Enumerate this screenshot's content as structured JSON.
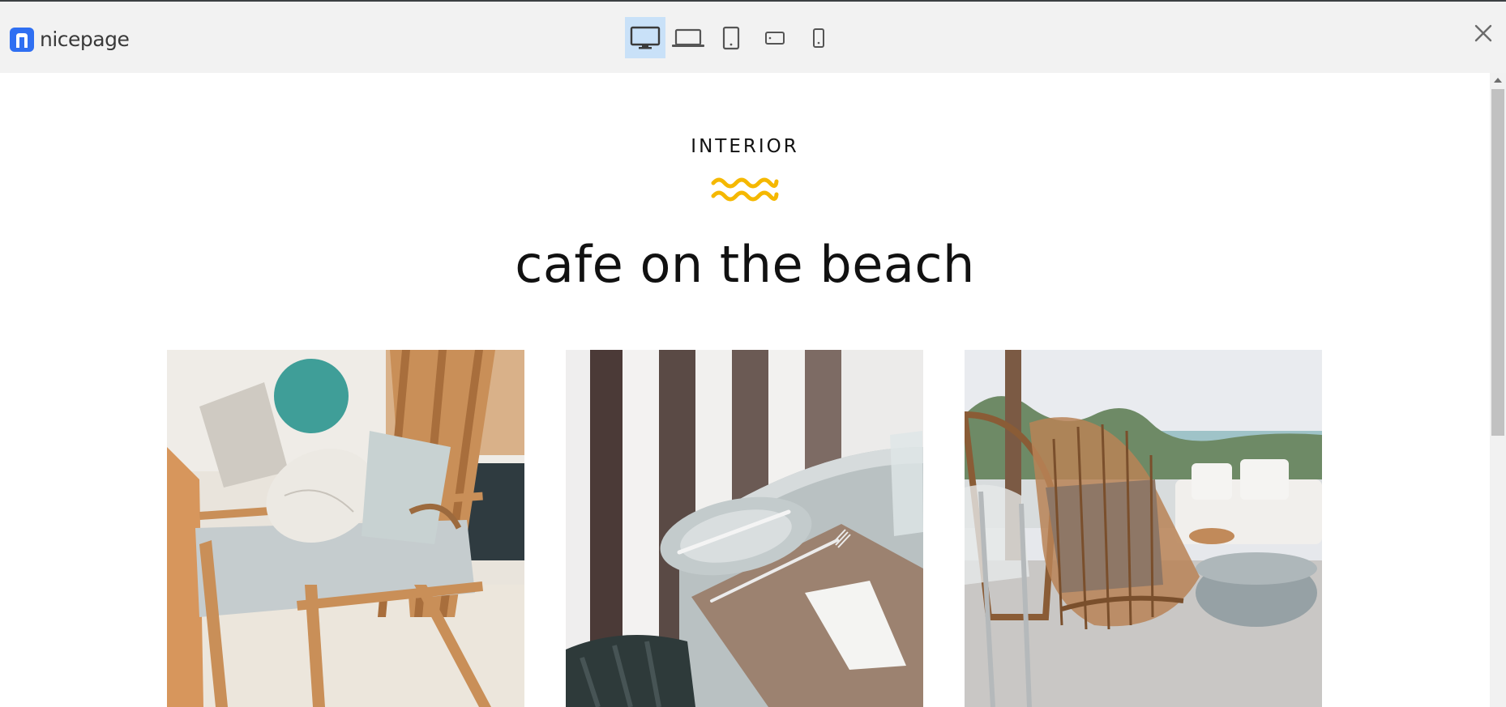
{
  "app": {
    "logo_text": "nicepage",
    "accent_color": "#2f6ff2",
    "devices": [
      {
        "name": "desktop",
        "icon": "monitor-icon",
        "active": true
      },
      {
        "name": "laptop",
        "icon": "laptop-icon",
        "active": false
      },
      {
        "name": "tablet",
        "icon": "tablet-icon",
        "active": false
      },
      {
        "name": "phone-landscape",
        "icon": "phone-landscape-icon",
        "active": false
      },
      {
        "name": "phone-portrait",
        "icon": "phone-portrait-icon",
        "active": false
      }
    ],
    "close_icon": "close-icon"
  },
  "page": {
    "kicker": "INTERIOR",
    "wave_color": "#f5b800",
    "title": "cafe on the beach",
    "images": [
      {
        "subject": "rattan armchair with cushions"
      },
      {
        "subject": "table setting with plate, fork and napkin"
      },
      {
        "subject": "wicker chairs on beach terrace"
      }
    ]
  }
}
